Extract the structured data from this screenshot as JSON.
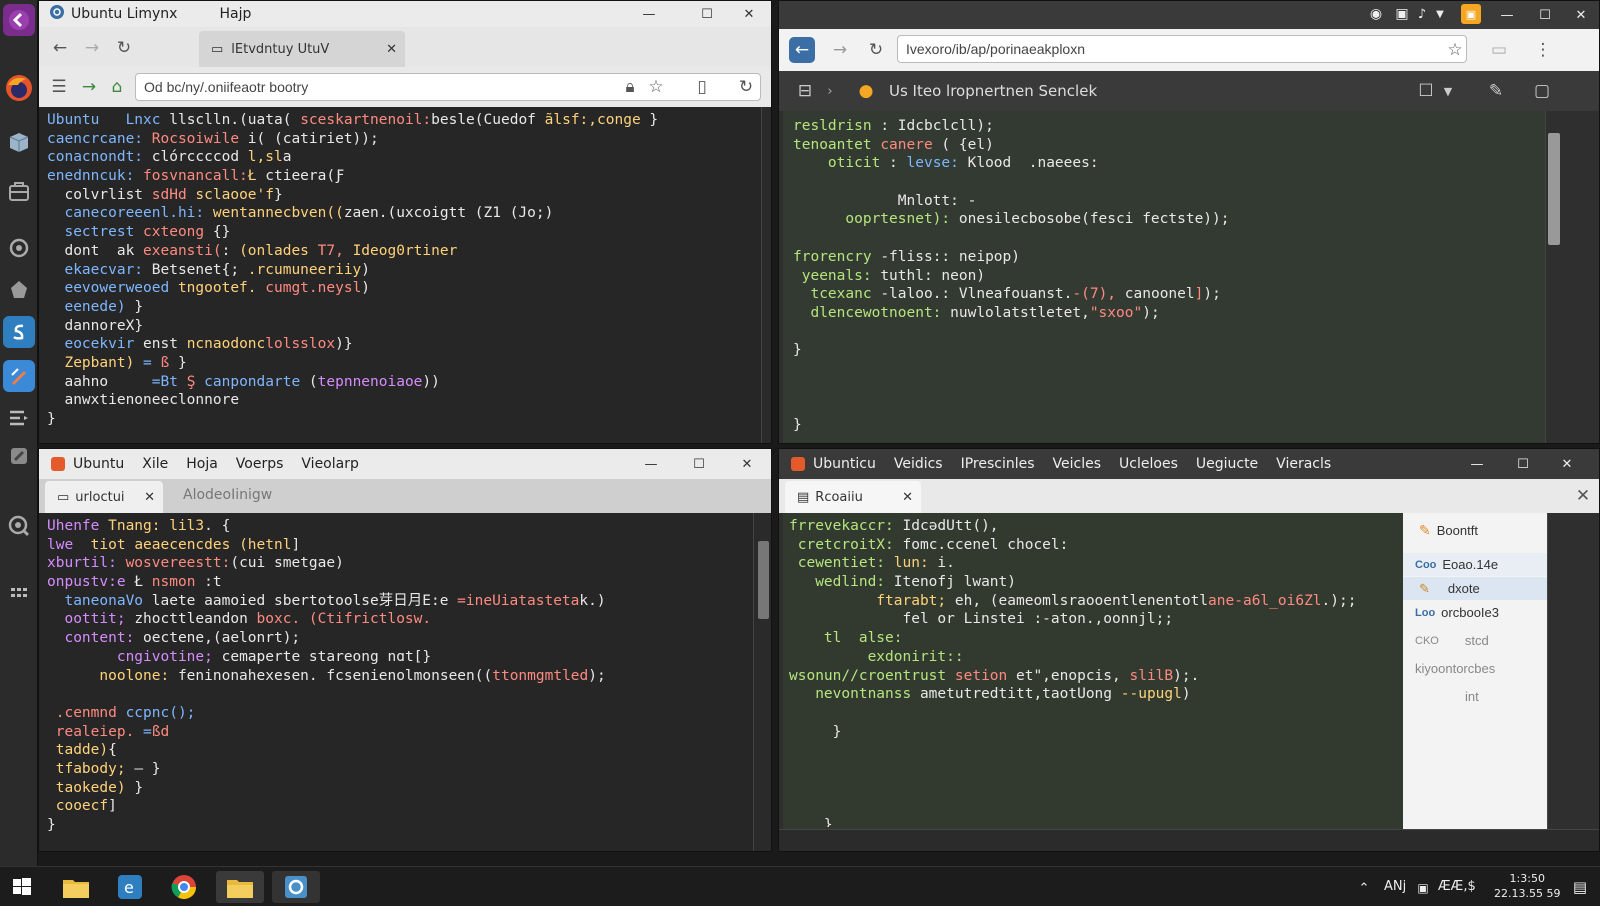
{
  "win1": {
    "title": "Ubuntu Limynx",
    "menu_help": "Hajp",
    "tab_label": "lEtvdntuy UtuV",
    "url": "Od bc/ny/.oniifeaotr bootry",
    "code": [
      [
        [
          "Ubuntu   ",
          "#7eb6ff"
        ],
        [
          "Lnxc ",
          "#7eb6ff"
        ],
        [
          "llsclln.(uata( ",
          "#e8e8e8"
        ],
        [
          "sceskartnenoil:",
          "#ff8a80"
        ],
        [
          "besle(Cuedof ",
          "#e8e8e8"
        ],
        [
          "ãlsf:,conge ",
          "#ffd27a"
        ],
        [
          "}",
          "#e8e8e8"
        ]
      ],
      [
        [
          "caencrcane: ",
          "#7eb6ff"
        ],
        [
          "Rocsoiwile ",
          "#ff8a80"
        ],
        [
          "i( (catiriet));",
          "#e8e8e8"
        ]
      ],
      [
        [
          "conacnondt: ",
          "#7eb6ff"
        ],
        [
          "clórccccod ",
          "#e8e8e8"
        ],
        [
          "l,sl",
          "#ffd27a"
        ],
        [
          "a",
          "#e8e8e8"
        ]
      ],
      [
        [
          "enednncuk: ",
          "#7eb6ff"
        ],
        [
          "fosvnancall:",
          "#ff8a80"
        ],
        [
          "Ł ",
          "#ffd27a"
        ],
        [
          "ctieera(Ƒ",
          "#e8e8e8"
        ]
      ],
      [
        [
          "  colvrlist ",
          "#e8e8e8"
        ],
        [
          "sdHd ",
          "#ff8a80"
        ],
        [
          "sclaooe'f",
          "#ffd27a"
        ],
        [
          "}",
          "#e8e8e8"
        ]
      ],
      [
        [
          "  canecoreeenl.hi: ",
          "#7eb6ff"
        ],
        [
          "wentannecbven((",
          "#ffd27a"
        ],
        [
          "zaen.(uxcoigtt ",
          "#e8e8e8"
        ],
        [
          "(Z1 (Jo;)",
          "#e8e8e8"
        ]
      ],
      [
        [
          "  sectrest ",
          "#7eb6ff"
        ],
        [
          "cxteong ",
          "#ff8a80"
        ],
        [
          "{}",
          "#e8e8e8"
        ]
      ],
      [
        [
          "  dont  ak ",
          "#e8e8e8"
        ],
        [
          "exeansti(",
          "#ff8a80"
        ],
        [
          ": ",
          "#e8e8e8"
        ],
        [
          "(onlades ",
          "#ffd27a"
        ],
        [
          "T7, ",
          "#ff8a80"
        ],
        [
          "Ideog0rtiner",
          "#ffd27a"
        ]
      ],
      [
        [
          "  ekaecvar: ",
          "#7eb6ff"
        ],
        [
          "Betsenet{; ",
          "#e8e8e8"
        ],
        [
          ".rcumuneeriiy",
          "#ffd27a"
        ],
        [
          ")",
          "#e8e8e8"
        ]
      ],
      [
        [
          "  eevowerweoed ",
          "#7eb6ff"
        ],
        [
          "tngootef. ",
          "#ffd27a"
        ],
        [
          "cumgt.neysl",
          "#ff8a80"
        ],
        [
          ")",
          "#e8e8e8"
        ]
      ],
      [
        [
          "  eenede) ",
          "#7eb6ff"
        ],
        [
          "}",
          "#e8e8e8"
        ]
      ],
      [
        [
          "  dannoreX",
          "#e8e8e8"
        ],
        [
          "}",
          "#e8e8e8"
        ]
      ],
      [
        [
          "  eocekvir ",
          "#7eb6ff"
        ],
        [
          "enst ",
          "#e8e8e8"
        ],
        [
          "ncnaodonc",
          "#ffd27a"
        ],
        [
          "lolsslox",
          "#ff8a80"
        ],
        [
          ")}",
          "#e8e8e8"
        ]
      ],
      [
        [
          "  Zepbant) ",
          "#ffd27a"
        ],
        [
          "= ",
          "#7eb6ff"
        ],
        [
          "ß ",
          "#ff8a80"
        ],
        [
          "}",
          "#e8e8e8"
        ]
      ],
      [
        [
          "  aahno     ",
          "#e8e8e8"
        ],
        [
          "=Bt ",
          "#7eb6ff"
        ],
        [
          "Ş ",
          "#ff8a80"
        ],
        [
          "canpondarte ",
          "#7eb6ff"
        ],
        [
          "(",
          "#e8e8e8"
        ],
        [
          "tepnnenoiaoe",
          "#d58cff"
        ],
        [
          ")",
          "#e8e8e8"
        ],
        [
          ")",
          "#e8e8e8"
        ]
      ],
      [
        [
          "  anwxtienoneeclonnore",
          "#e8e8e8"
        ]
      ],
      [
        [
          "}",
          "#e8e8e8"
        ]
      ]
    ]
  },
  "win2": {
    "url": "Ivexoro/ib/ap/porinaeakploxn",
    "breadcrumb": "Us Iteo lropnertnen Senclek",
    "code": [
      [
        [
          "resldrisn ",
          "#b5e57d"
        ],
        [
          ": ",
          "#e8e8e8"
        ],
        [
          "Idcbclcll);",
          "#e8e8e8"
        ]
      ],
      [
        [
          "tenoantet ",
          "#b5e57d"
        ],
        [
          "canere ",
          "#ff8a80"
        ],
        [
          "( {el)",
          "#e8e8e8"
        ]
      ],
      [
        [
          "    oticit ",
          "#b5e57d"
        ],
        [
          ": ",
          "#e8e8e8"
        ],
        [
          "levse:",
          "#7eb6ff"
        ],
        [
          " Klood  ",
          "#e8e8e8"
        ],
        [
          ".naeees:",
          "#e8e8e8"
        ]
      ],
      [
        [
          "",
          "#e8e8e8"
        ]
      ],
      [
        [
          "            Mnlott: -",
          "#e8e8e8"
        ]
      ],
      [
        [
          "      ooprtesnet): ",
          "#b5e57d"
        ],
        [
          "onesilecbosobe(fesci fectste));",
          "#e8e8e8"
        ]
      ],
      [
        [
          "",
          "#e8e8e8"
        ]
      ],
      [
        [
          "frorencry ",
          "#b5e57d"
        ],
        [
          "-fliss:: ",
          "#e8e8e8"
        ],
        [
          "neipop)",
          "#e8e8e8"
        ]
      ],
      [
        [
          " yeenals: ",
          "#b5e57d"
        ],
        [
          "tuthl: ",
          "#e8e8e8"
        ],
        [
          "neon)",
          "#e8e8e8"
        ]
      ],
      [
        [
          "  tcexanc ",
          "#b5e57d"
        ],
        [
          "-laloo.: ",
          "#e8e8e8"
        ],
        [
          "Vlneafouanst.",
          "#e8e8e8"
        ],
        [
          "-(7), ",
          "#ff8a80"
        ],
        [
          "canoonel",
          "#e8e8e8"
        ],
        [
          "]",
          "#ff8a80"
        ],
        [
          ");",
          "#e8e8e8"
        ]
      ],
      [
        [
          "  dlencewotnoent: ",
          "#b5e57d"
        ],
        [
          "nuwlolatstletet,",
          "#e8e8e8"
        ],
        [
          "\"sxoo\"",
          "#ff8a80"
        ],
        [
          ");",
          "#e8e8e8"
        ]
      ],
      [
        [
          "",
          "#e8e8e8"
        ]
      ],
      [
        [
          "}",
          "#e8e8e8"
        ]
      ],
      [
        [
          "",
          "#e8e8e8"
        ]
      ],
      [
        [
          "",
          "#e8e8e8"
        ]
      ],
      [
        [
          "",
          "#e8e8e8"
        ]
      ],
      [
        [
          "}",
          "#e8e8e8"
        ]
      ]
    ]
  },
  "win3": {
    "menu": [
      "Ubuntu",
      "Xile",
      "Hoja",
      "Voerps",
      "Vieolarp"
    ],
    "tab_label": "urloctui",
    "tab2_label": "AlodeoIinigw",
    "code": [
      [
        [
          "Uhenfe ",
          "#d58cff"
        ],
        [
          "Tnang: ",
          "#ffd27a"
        ],
        [
          "lil3",
          "#ffd27a"
        ],
        [
          ". {",
          "#e8e8e8"
        ]
      ],
      [
        [
          "lwe  ",
          "#d58cff"
        ],
        [
          "tiot ",
          "#ffd27a"
        ],
        [
          "aeaecencdes ",
          "#ffd27a"
        ],
        [
          "(hetnl",
          "#ffd27a"
        ],
        [
          "]",
          "#e8e8e8"
        ]
      ],
      [
        [
          "xburtil: ",
          "#d58cff"
        ],
        [
          "wosvereestt:",
          "#ff8a80"
        ],
        [
          "(cui smetgae)",
          "#e8e8e8"
        ]
      ],
      [
        [
          "onpustv:e ",
          "#d58cff"
        ],
        [
          "Ł ",
          "#e8e8e8"
        ],
        [
          "nsmon ",
          "#ff8a80"
        ],
        [
          ":t",
          "#e8e8e8"
        ]
      ],
      [
        [
          "  taneonaVo ",
          "#7eb6ff"
        ],
        [
          "laete aamoied sbertotoolse",
          "#e8e8e8"
        ],
        [
          "芽日月E:e ",
          "#e8e8e8"
        ],
        [
          "=ineUiatasteta",
          "#ff8a80"
        ],
        [
          "k",
          ".#e8e8e8"
        ],
        [
          ".)",
          "#e8e8e8"
        ]
      ],
      [
        [
          "  oottit; ",
          "#d58cff"
        ],
        [
          "zhocttleandon ",
          "#e8e8e8"
        ],
        [
          "boxc. (Ctifrictlosw.",
          "#ff8a80"
        ]
      ],
      [
        [
          "  content: ",
          "#d58cff"
        ],
        [
          "oectene,(aelonrt);",
          "#e8e8e8"
        ]
      ],
      [
        [
          "        cngivotine; ",
          "#d58cff"
        ],
        [
          "cemaperte stareong ",
          "#e8e8e8"
        ],
        [
          "nɑt[}",
          "#e8e8e8"
        ]
      ],
      [
        [
          "      noolone: ",
          "#ffd27a"
        ],
        [
          "feninonahexesen. ",
          "#e8e8e8"
        ],
        [
          "fcsenienolmonseen((",
          "#e8e8e8"
        ],
        [
          "ttonmgmtled",
          "#ff8a80"
        ],
        [
          ");",
          "#e8e8e8"
        ]
      ],
      [
        [
          "",
          "#e8e8e8"
        ]
      ],
      [
        [
          " .cenmnd ",
          "#ff8a80"
        ],
        [
          "ccpnc();",
          "#7eb6ff"
        ]
      ],
      [
        [
          " realeiep. ",
          "#ff8a80"
        ],
        [
          "=",
          "#7eb6ff"
        ],
        [
          "ßd",
          "#ff8a80"
        ]
      ],
      [
        [
          " tadde)",
          "#ffd27a"
        ],
        [
          "{",
          "#e8e8e8"
        ]
      ],
      [
        [
          " tfabody; ",
          "#ffd27a"
        ],
        [
          "— }",
          "#e8e8e8"
        ]
      ],
      [
        [
          " taokede) ",
          "#ffd27a"
        ],
        [
          "}",
          "#e8e8e8"
        ]
      ],
      [
        [
          " cooecf",
          "#ffd27a"
        ],
        [
          "]",
          "#e8e8e8"
        ]
      ],
      [
        [
          "}",
          "#e8e8e8"
        ]
      ]
    ]
  },
  "win4": {
    "menu": [
      "Ubunticu",
      "Veidics",
      "IPrescinles",
      "Veicles",
      "Ucleloes",
      "Uegiucte",
      "Vieracls"
    ],
    "tab_label": "Rcoaiiu",
    "code": [
      [
        [
          "frrevekaccr: ",
          "#b5e57d"
        ],
        [
          "IdcǝdUtt(),",
          "#e8e8e8"
        ]
      ],
      [
        [
          " cretcroitX: ",
          "#b5e57d"
        ],
        [
          "fomc.ccenel ",
          "#e8e8e8"
        ],
        [
          "chocel:",
          "#e8e8e8"
        ]
      ],
      [
        [
          " cewentiet: ",
          "#b5e57d"
        ],
        [
          "lun: ",
          "#ffd27a"
        ],
        [
          "i.",
          "#e8e8e8"
        ]
      ],
      [
        [
          "   wedlind: ",
          "#b5e57d"
        ],
        [
          "Itenofj lwant)",
          "#e8e8e8"
        ]
      ],
      [
        [
          "          ftarabt; ",
          "#ffd27a"
        ],
        [
          "eh, ",
          "#e8e8e8"
        ],
        [
          "(eameomlsraooentlenentotl",
          "#e8e8e8"
        ],
        [
          "ane-a6l_oi6Zl",
          "#ff8a80"
        ],
        [
          ".);;",
          "#e8e8e8"
        ]
      ],
      [
        [
          "             fel or Linstei ",
          "#e8e8e8"
        ],
        [
          ":-aton.,oonnjl;;",
          "#e8e8e8"
        ]
      ],
      [
        [
          "    tl  alse:",
          "#b5e57d"
        ]
      ],
      [
        [
          "         exdonirit::",
          "#b5e57d"
        ]
      ],
      [
        [
          "wsonun//croentrust ",
          "#b5e57d"
        ],
        [
          "setion ",
          "#ff8a80"
        ],
        [
          "et\",enopcis, ",
          "#e8e8e8"
        ],
        [
          "slilB",
          "#ff8a80"
        ],
        [
          ");.",
          "#e8e8e8"
        ]
      ],
      [
        [
          "   nevontnanss ",
          "#b5e57d"
        ],
        [
          "ametutredtitt,",
          "#e8e8e8"
        ],
        [
          "taotUong ",
          "#e8e8e8"
        ],
        [
          "--upugl",
          "#ffd27a"
        ],
        [
          ")",
          "#e8e8e8"
        ]
      ],
      [
        [
          "",
          "#e8e8e8"
        ]
      ],
      [
        [
          "     }",
          "#e8e8e8"
        ]
      ],
      [
        [
          "",
          "#e8e8e8"
        ]
      ],
      [
        [
          "",
          "#e8e8e8"
        ]
      ],
      [
        [
          "",
          "#e8e8e8"
        ]
      ],
      [
        [
          "",
          "#e8e8e8"
        ]
      ],
      [
        [
          "    }",
          "#e8e8e8"
        ]
      ]
    ],
    "side": [
      "Boontft",
      "Eoao.14e",
      "dxote",
      "orcbooIe3",
      "stcd",
      "kiyoontorcbes",
      "int"
    ],
    "side_prefix": [
      "",
      "Coo",
      "",
      "Loo",
      "CKO",
      "",
      ""
    ]
  },
  "taskbar": {
    "tray": [
      "ANj",
      "ÆÆ,$"
    ],
    "time": "1:3:50",
    "date": "22.13.55 59"
  },
  "colors": {
    "launcher": "#2b2b2b",
    "editor": "#2a2a2a",
    "green_editor": "#323a30"
  }
}
